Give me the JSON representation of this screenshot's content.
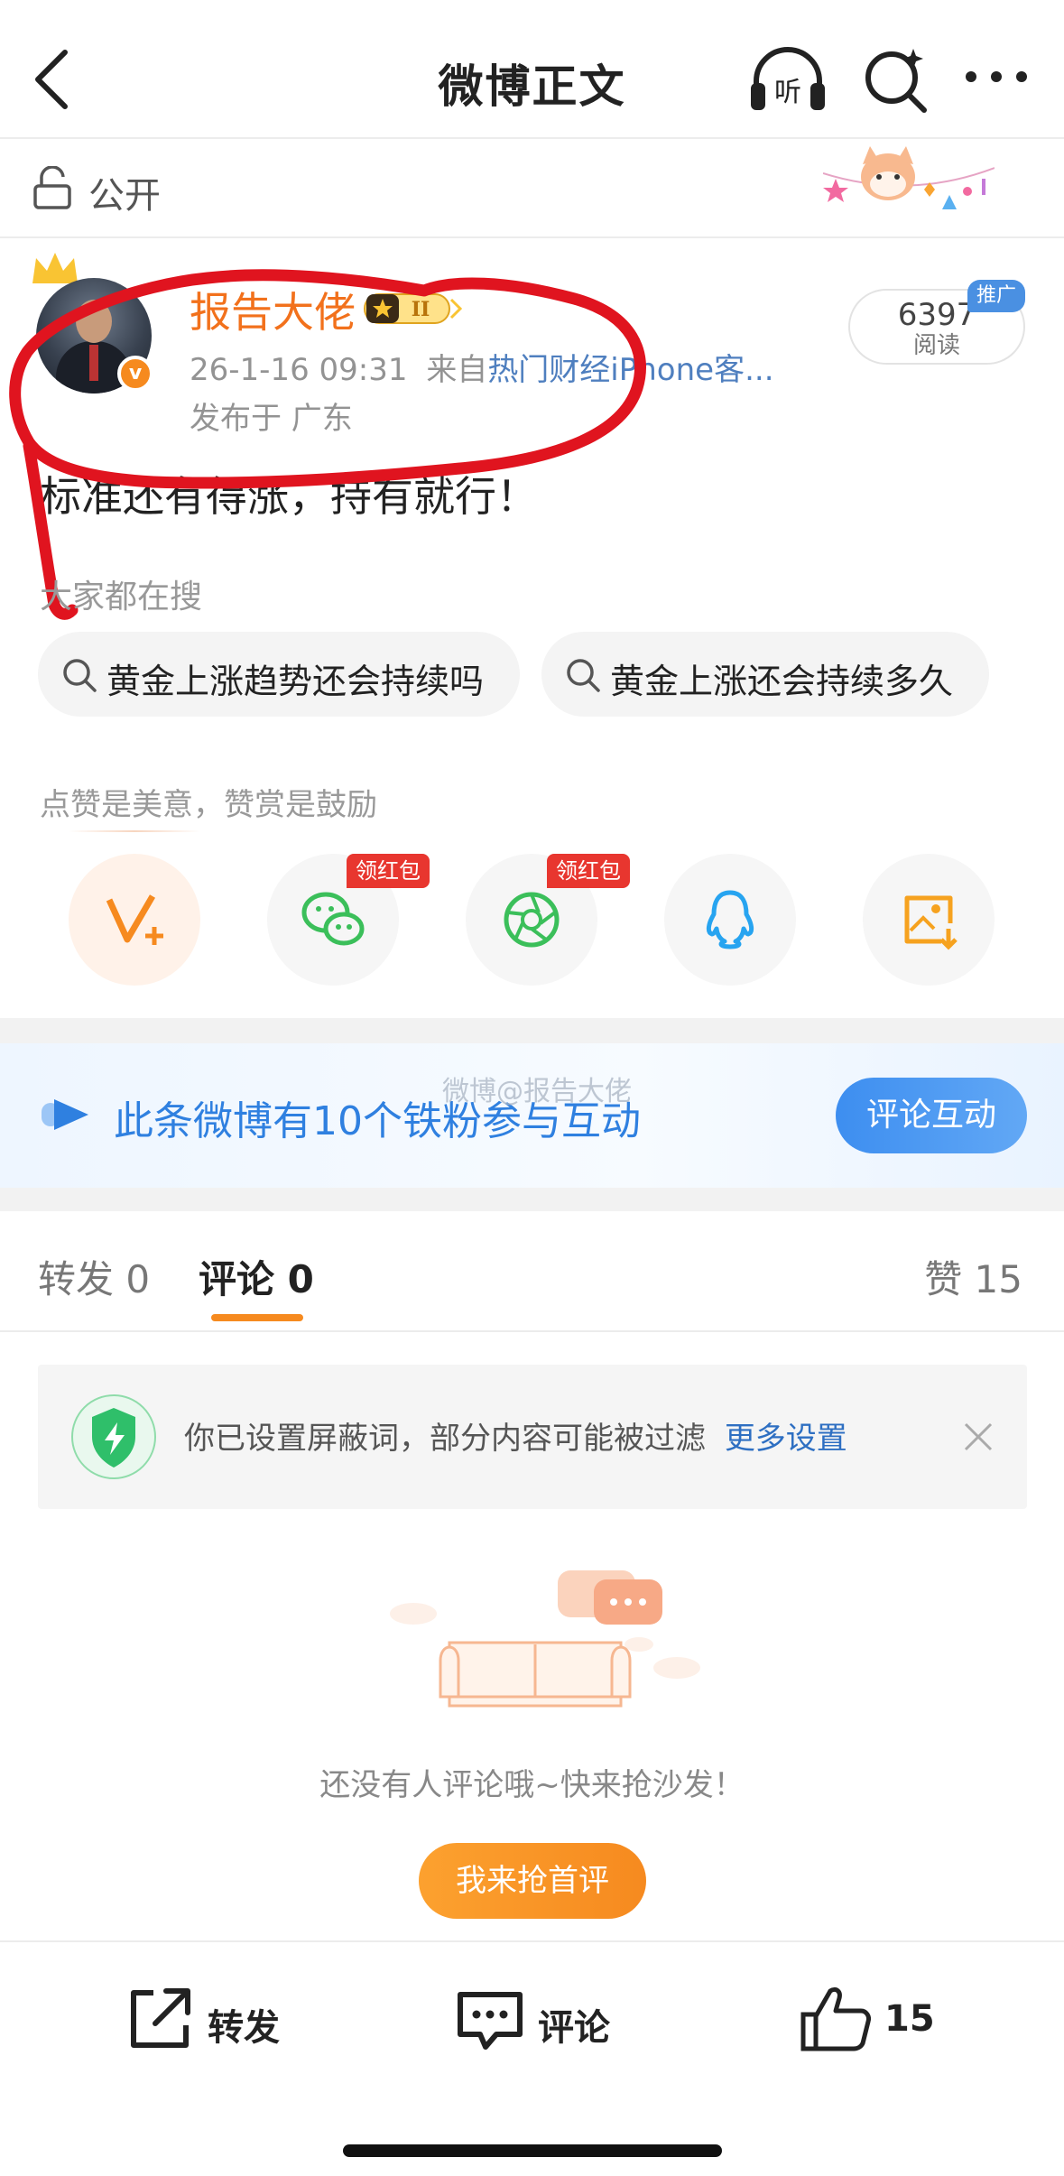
{
  "nav": {
    "title": "微博正文",
    "listen_label": "听"
  },
  "visibility": {
    "label": "公开"
  },
  "author": {
    "name": "报告大佬",
    "rank_badge": "II",
    "verified_mark": "v",
    "time": "26-1-16 09:31",
    "from_prefix": "来自",
    "source": "热门财经iPhone客...",
    "location": "发布于 广东"
  },
  "reads": {
    "count": "6397",
    "label": "阅读",
    "promo": "推广"
  },
  "post": {
    "text": "标准还有得涨，持有就行！"
  },
  "searching": {
    "label": "大家都在搜",
    "chips": [
      "黄金上涨趋势还会持续吗",
      "黄金上涨还会持续多久"
    ]
  },
  "share": {
    "tagline": "点赞是美意，赞赏是鼓励",
    "red_packet_tag": "领红包",
    "targets": [
      "support-vplus",
      "wechat",
      "moments",
      "qq",
      "save-image"
    ]
  },
  "banner": {
    "text": "此条微博有10个铁粉参与互动",
    "button": "评论互动",
    "watermark": "微博@报告大佬"
  },
  "tabs": {
    "repost": "转发 0",
    "comment": "评论 0",
    "like": "赞 15"
  },
  "notice": {
    "text": "你已设置屏蔽词，部分内容可能被过滤",
    "link": "更多设置"
  },
  "empty": {
    "text": "还没有人评论哦~快来抢沙发！",
    "button": "我来抢首评"
  },
  "bottombar": {
    "repost": "转发",
    "comment": "评论",
    "like_count": "15"
  },
  "colors": {
    "brand_orange": "#f68a1f",
    "link_blue": "#2e6fc2",
    "banner_blue": "#2f80e0",
    "red_tag": "#e8362f"
  }
}
